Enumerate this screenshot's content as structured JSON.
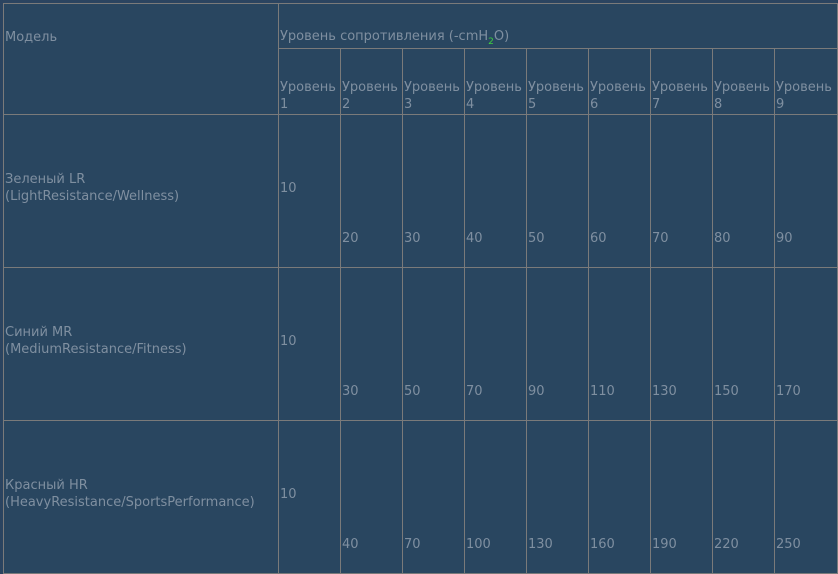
{
  "header": {
    "model_label": "Модель",
    "resistance_prefix": "Уровень сопротивления (-cmH",
    "resistance_sub": "2",
    "resistance_suffix": "O)"
  },
  "levels": [
    "Уровень 1",
    "Уровень 2",
    "Уровень 3",
    "Уровень 4",
    "Уровень 5",
    "Уровень 6",
    "Уровень 7",
    "Уровень 8",
    "Уровень 9"
  ],
  "rows": [
    {
      "model_line1": "Зеленый LR",
      "model_line2": "(LightResistance/Wellness)",
      "values": [
        "10",
        "20",
        "30",
        "40",
        "50",
        "60",
        "70",
        "80",
        "90"
      ]
    },
    {
      "model_line1": "Синий MR",
      "model_line2": "(MediumResistance/Fitness)",
      "values": [
        "10",
        "30",
        "50",
        "70",
        "90",
        "110",
        "130",
        "150",
        "170"
      ]
    },
    {
      "model_line1": "Красный HR",
      "model_line2": "(HeavyResistance/SportsPerformance)",
      "values": [
        "10",
        "40",
        "70",
        "100",
        "130",
        "160",
        "190",
        "220",
        "250"
      ]
    }
  ],
  "colors": {
    "background": "#294660",
    "border": "#7a7a7a",
    "text": "#7f8fa0",
    "subscript": "#3ecf3e"
  }
}
